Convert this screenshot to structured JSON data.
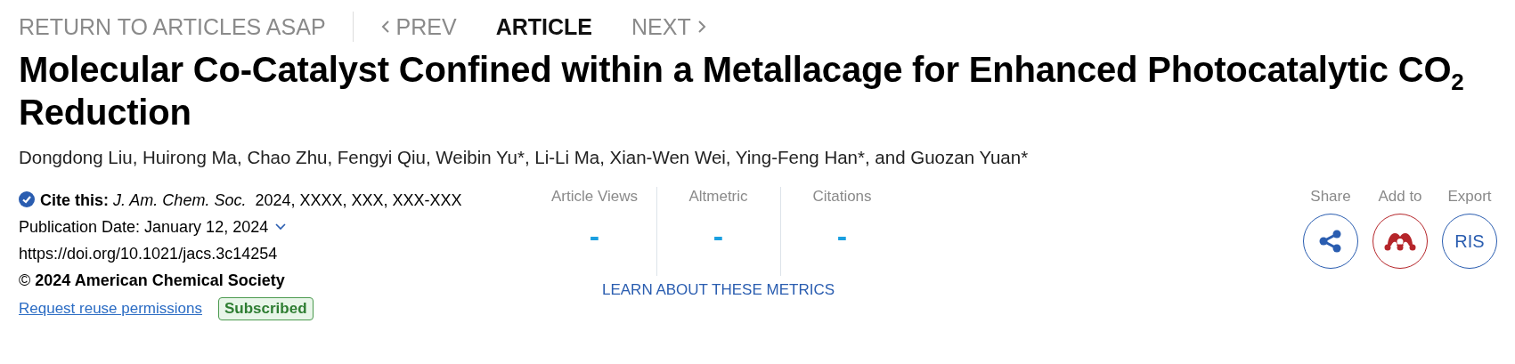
{
  "nav": [
    {
      "label": "RETURN TO ARTICLES ASAP",
      "kind": "back",
      "selected": false
    },
    {
      "label": "PREV",
      "kind": "prev",
      "selected": false
    },
    {
      "label": "ARTICLE",
      "kind": "current",
      "selected": true
    },
    {
      "label": "NEXT",
      "kind": "next",
      "selected": false
    }
  ],
  "title": "Molecular Co-Catalyst Confined within a Metallacage for Enhanced Photocatalytic CO$_{2}$ Reduction",
  "authors": "Dongdong Liu, Huirong Ma, Chao Zhu, Fengyi Qiu, Weibin Yu*, Li-Li Ma, Xian-Wen Wei, Ying-Feng Han*, and Guozan Yuan*",
  "citation": "**Cite this:** *J. Am. Chem. Soc.*  2024, XXXX, XXX, XXX-XXX",
  "publication_date": "Publication Date: January 12, 2024",
  "doi": "https://doi.org/10.1021/jacs.3c14254",
  "copyright": "© **2024 American Chemical Society**",
  "reuse_link": "Request reuse permissions",
  "access_badge": "Subscribed",
  "metrics": [
    {
      "label": "Article Views",
      "value": "-"
    },
    {
      "label": "Altmetric",
      "value": "-"
    },
    {
      "label": "Citations",
      "value": "-"
    }
  ],
  "metrics_link": "LEARN ABOUT THESE METRICS",
  "actions": [
    {
      "label": "Share",
      "kind": "share"
    },
    {
      "label": "Add to",
      "kind": "mendeley"
    },
    {
      "label": "Export",
      "kind": "ris",
      "button_text": "RIS"
    }
  ]
}
